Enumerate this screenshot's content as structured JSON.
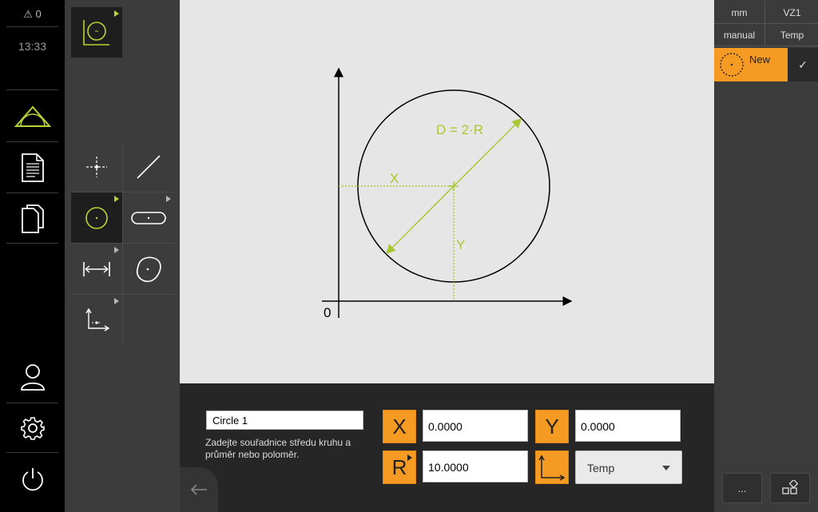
{
  "sidebar": {
    "message_count": "⚠ 0",
    "clock": "13:33",
    "items": [
      {
        "name": "measure",
        "icon": "measure-icon"
      },
      {
        "name": "measurement-report",
        "icon": "report-icon"
      },
      {
        "name": "file-management",
        "icon": "files-icon"
      },
      {
        "name": "user-login",
        "icon": "user-icon"
      },
      {
        "name": "settings",
        "icon": "gear-icon"
      },
      {
        "name": "switch-off",
        "icon": "power-icon"
      }
    ]
  },
  "palette": {
    "selected_tool": "circle",
    "tools": [
      "manual-measurement",
      "point",
      "line",
      "circle",
      "slot",
      "distance",
      "blob",
      "reference-system"
    ]
  },
  "diagram": {
    "diameter_label": "D = 2·R",
    "x_label": "X",
    "y_label": "Y",
    "origin_label": "0"
  },
  "input": {
    "name_value": "Circle 1",
    "hint": "Zadejte souřadnice středu kruhu a průměr nebo poloměr.",
    "x_label": "X",
    "x_value": "0.0000",
    "y_label": "Y",
    "y_value": "0.0000",
    "r_label": "R",
    "r_value": "10.0000",
    "reference_value": "Temp"
  },
  "inspector": {
    "quick_access": {
      "unit": "mm",
      "preset": "VZ1",
      "mode": "manual",
      "reference": "Temp"
    },
    "new_feature_label": "New",
    "confirm_glyph": "✓",
    "more_label": "..."
  },
  "colors": {
    "accent_orange": "#f59a23",
    "accent_green": "#b7d433",
    "diagram_green": "#a8c832"
  }
}
